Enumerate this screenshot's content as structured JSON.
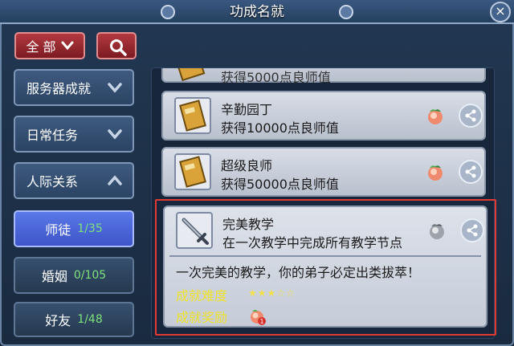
{
  "window": {
    "title": "功成名就",
    "close_label": "×"
  },
  "toolbar": {
    "filter_label": "全 部"
  },
  "sidebar": {
    "categories": [
      {
        "label": "服务器成就"
      },
      {
        "label": "日常任务"
      },
      {
        "label": "人际关系"
      }
    ],
    "subitems": [
      {
        "label": "师徒",
        "progress": "1/35",
        "active": true
      },
      {
        "label": "婚姻",
        "progress": "0/105",
        "active": false
      },
      {
        "label": "好友",
        "progress": "1/48",
        "active": false
      }
    ]
  },
  "achievements": {
    "partial_top_desc": "获得5000点良师值",
    "items": [
      {
        "name": "辛勤园丁",
        "desc": "获得10000点良师值"
      },
      {
        "name": "超级良师",
        "desc": "获得50000点良师值"
      }
    ],
    "selected": {
      "name": "完美教学",
      "desc": "在一次教学中完成所有教学节点",
      "flavor": "一次完美的教学，你的弟子必定出类拔萃！",
      "difficulty_label": "成就难度",
      "difficulty_stars": "★★★☆☆",
      "difficulty_value": 3,
      "difficulty_max": 5,
      "reward_label": "成就奖励",
      "reward_badge": "1"
    }
  },
  "colors": {
    "accent_red": "#b4393f",
    "active_tab": "#4a66d8",
    "progress_green": "#7fe27c",
    "label_yellow": "#f0e22a",
    "highlight_border": "#e23a32"
  },
  "icons": {
    "filter_dropdown": "chevron-down-icon",
    "search": "search-icon",
    "menu_collapsed": "chevron-down-icon",
    "menu_expanded": "chevron-up-icon",
    "share": "share-icon",
    "reward": "peach-icon",
    "badge": "scroll-badge-icon",
    "sword": "sword-icon"
  }
}
